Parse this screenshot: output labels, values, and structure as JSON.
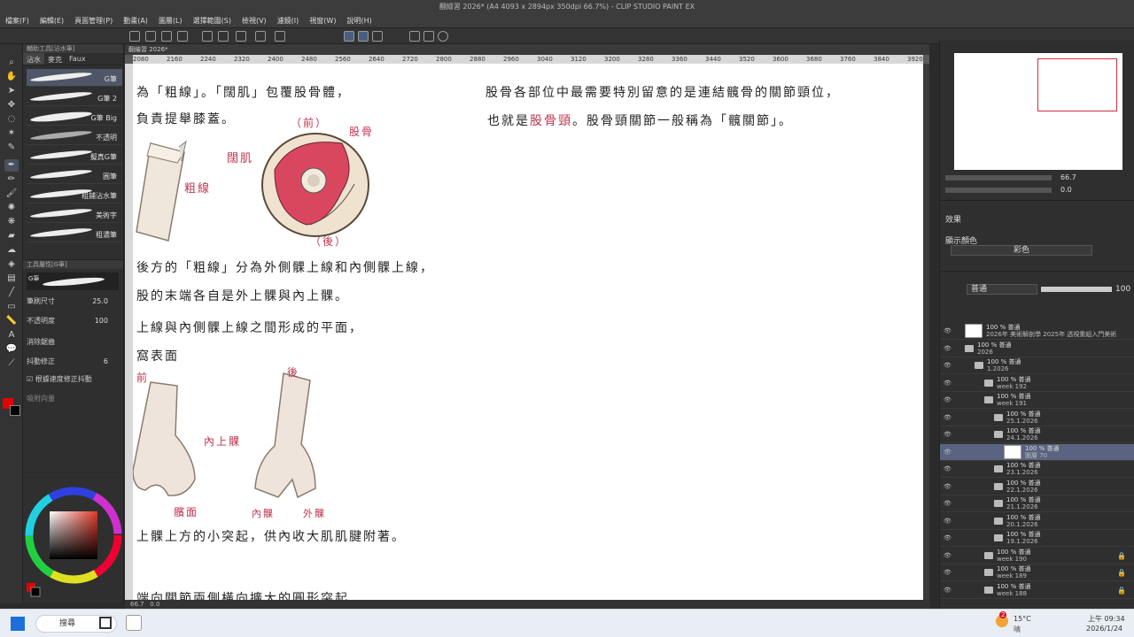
{
  "window": {
    "title": "翻繪習 2026* (A4 4093 x 2894px 350dpi 66.7%) - CLIP STUDIO PAINT EX"
  },
  "menu": [
    "檔案(F)",
    "編輯(E)",
    "頁面管理(P)",
    "動畫(A)",
    "圖層(L)",
    "選擇範圍(S)",
    "檢視(V)",
    "濾鏡(I)",
    "視窗(W)",
    "說明(H)"
  ],
  "subtool": {
    "header": "輔助工具[沾水筆]",
    "tabs": [
      "沾水",
      "麥克",
      "Faux"
    ],
    "brushes": [
      "G筆",
      "G筆 2",
      "G筆 Big",
      "不透明",
      "擬真G筆",
      "圓筆",
      "粗鋪沾水筆",
      "美術字",
      "粗濃筆"
    ]
  },
  "toolprop": {
    "header": "工具屬性[G筆]",
    "preset": "G筆",
    "brush_size_label": "筆刷尺寸",
    "brush_size_value": "25.0",
    "opacity_label": "不透明度",
    "opacity_value": "100",
    "antialias_label": "消除鋸齒",
    "stabilization_label": "抖動修正",
    "stabilization_value": "6",
    "speed_label": "根據速度修正抖動",
    "vector_label": "向量吸附",
    "vector_label_full": "吸附向量"
  },
  "document": {
    "tab": "翻繪習 2026*",
    "ruler": [
      "2080",
      "2160",
      "2240",
      "2320",
      "2400",
      "2480",
      "2560",
      "2640",
      "2720",
      "2800",
      "2880",
      "2960",
      "3040",
      "3120",
      "3200",
      "3280",
      "3360",
      "3440",
      "3520",
      "3600",
      "3680",
      "3760",
      "3840",
      "3920"
    ],
    "zoom": "66.7",
    "coord": "0.0"
  },
  "notes": {
    "line1": "為「粗線」。「闊肌」包覆股骨體，",
    "line2": "負責提舉膝蓋。",
    "right1": "股骨各部位中最需要特別留意的是連結髖骨的關節頸位，",
    "right2_a": "也就是",
    "right2_red": "股骨頸",
    "right2_b": "。股骨頸關節一般稱為「髖關節」。",
    "label_front": "（前）",
    "label_back": "（後）",
    "label_bone": "股骨",
    "label_muscle": "闊肌",
    "label_linea": "粗線",
    "line3": "後方的「粗線」分為外側髁上線和內側髁上線，",
    "line4": "股的末端各自是外上髁與內上髁。",
    "line5": "上線與內側髁上線之間形成的平面，",
    "line6": "窩表面",
    "label_front2": "前",
    "label_back2": "後",
    "label_medial_epi": "內上髁",
    "label_patellar": "髕面",
    "label_med_condyle": "內髁",
    "label_lat_condyle": "外髁",
    "line7": "上髁上方的小突起，供內收大肌肌腱附著。",
    "line8": "端向關節兩側橫向擴大的圓形突起"
  },
  "navigator": {
    "zoom": "66.7",
    "angle": "0.0"
  },
  "layerprop": {
    "effect_label": "效果",
    "display_color_label": "顯示顏色",
    "color_value": "彩色"
  },
  "layers": {
    "blend_mode": "普通",
    "opacity": "100",
    "items": [
      {
        "name1": "100 % 普通",
        "name2": "2026年 美術解剖學 2025年 透視重組入門美術",
        "indent": 0,
        "sel": false,
        "type": "text"
      },
      {
        "name1": "100 % 普通",
        "name2": "2026",
        "indent": 0,
        "sel": false,
        "type": "folder"
      },
      {
        "name1": "100 % 普通",
        "name2": "1.2026",
        "indent": 1,
        "sel": false,
        "type": "folder"
      },
      {
        "name1": "100 % 普通",
        "name2": "week 192",
        "indent": 2,
        "sel": false,
        "type": "folder"
      },
      {
        "name1": "100 % 普通",
        "name2": "week 191",
        "indent": 2,
        "sel": false,
        "type": "folder"
      },
      {
        "name1": "100 % 普通",
        "name2": "25.1.2026",
        "indent": 3,
        "sel": false,
        "type": "folder"
      },
      {
        "name1": "100 % 普通",
        "name2": "24.1.2026",
        "indent": 3,
        "sel": false,
        "type": "folder"
      },
      {
        "name1": "100 % 普通",
        "name2": "圖層 70",
        "indent": 4,
        "sel": true,
        "type": "raster"
      },
      {
        "name1": "100 % 普通",
        "name2": "23.1.2026",
        "indent": 3,
        "sel": false,
        "type": "folder"
      },
      {
        "name1": "100 % 普通",
        "name2": "22.1.2026",
        "indent": 3,
        "sel": false,
        "type": "folder"
      },
      {
        "name1": "100 % 普通",
        "name2": "21.1.2026",
        "indent": 3,
        "sel": false,
        "type": "folder"
      },
      {
        "name1": "100 % 普通",
        "name2": "20.1.2026",
        "indent": 3,
        "sel": false,
        "type": "folder"
      },
      {
        "name1": "100 % 普通",
        "name2": "19.1.2026",
        "indent": 3,
        "sel": false,
        "type": "folder"
      },
      {
        "name1": "100 % 普通",
        "name2": "week 190",
        "indent": 2,
        "sel": false,
        "type": "folder"
      },
      {
        "name1": "100 % 普通",
        "name2": "week 189",
        "indent": 2,
        "sel": false,
        "type": "folder"
      },
      {
        "name1": "100 % 普通",
        "name2": "week 188",
        "indent": 2,
        "sel": false,
        "type": "folder"
      }
    ]
  },
  "taskbar": {
    "search": "搜尋",
    "temp": "15°C",
    "weather": "晴",
    "badge": "2",
    "time": "上午 09:34",
    "date": "2026/1/24"
  },
  "colors": {
    "main": "#e30000",
    "sub": "#000000",
    "accent": "#c0344e"
  }
}
